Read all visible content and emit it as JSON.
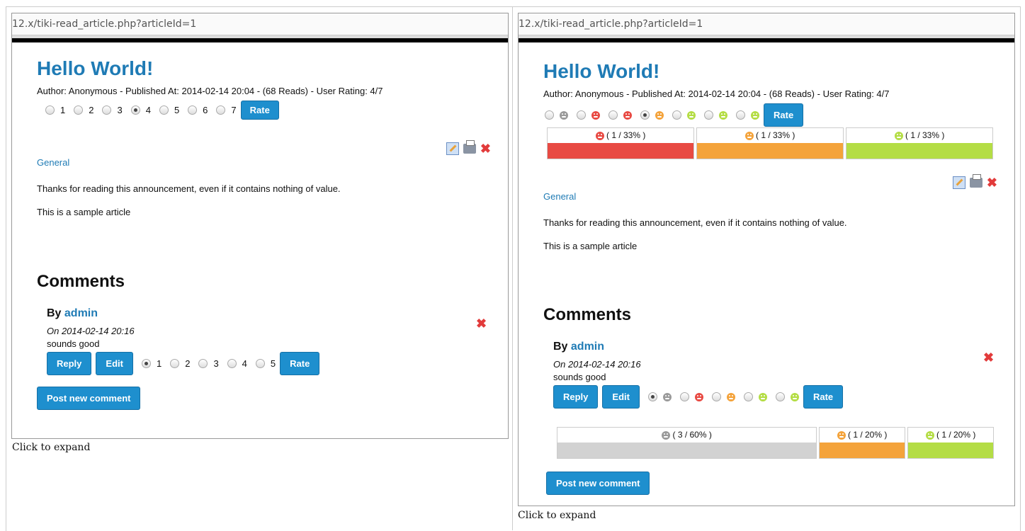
{
  "colors": {
    "link": "#1f7bb5",
    "button": "#1e8fce",
    "bad": "#e84a43",
    "neutral": "#f4a33b",
    "good": "#b4dd45",
    "gray": "#d2d2d2",
    "delete": "#e23b3b"
  },
  "left": {
    "url": "12.x/tiki-read_article.php?articleId=1",
    "title": "Hello World!",
    "meta": "Author: Anonymous - Published At: 2014-02-14 20:04 - (68 Reads) - User Rating: 4/7",
    "rating_options": [
      "1",
      "2",
      "3",
      "4",
      "5",
      "6",
      "7"
    ],
    "rating_selected": "4",
    "rate_label": "Rate",
    "category": "General",
    "para1": "Thanks for reading this announcement, even if it contains nothing of value.",
    "para2": "This is a sample article",
    "comments_heading": "Comments",
    "comment": {
      "by": "By",
      "author": "admin",
      "date": "On 2014-02-14 20:16",
      "text": "sounds good",
      "reply": "Reply",
      "edit": "Edit",
      "rating_options": [
        "1",
        "2",
        "3",
        "4",
        "5"
      ],
      "rating_selected": "1",
      "rate": "Rate"
    },
    "post_new": "Post new comment",
    "caption": "Click to expand"
  },
  "right": {
    "url": "12.x/tiki-read_article.php?articleId=1",
    "title": "Hello World!",
    "meta": "Author: Anonymous - Published At: 2014-02-14 20:04 - (68 Reads) - User Rating: 4/7",
    "rating_icons": [
      "face-gray-icon",
      "face-sad-icon",
      "face-sad-icon",
      "face-neutral-icon",
      "face-happy-icon",
      "face-happy-icon",
      "face-happy-icon"
    ],
    "rating_selected_index": 3,
    "rate_label": "Rate",
    "distribution": [
      {
        "label": "( 1 / 33% )",
        "icon": "face-sad-icon",
        "share": 0.33
      },
      {
        "label": "( 1 / 33% )",
        "icon": "face-neutral-icon",
        "share": 0.33
      },
      {
        "label": "( 1 / 33% )",
        "icon": "face-happy-icon",
        "share": 0.33
      }
    ],
    "category": "General",
    "para1": "Thanks for reading this announcement, even if it contains nothing of value.",
    "para2": "This is a sample article",
    "comments_heading": "Comments",
    "comment": {
      "by": "By",
      "author": "admin",
      "date": "On 2014-02-14 20:16",
      "text": "sounds good",
      "reply": "Reply",
      "edit": "Edit",
      "rating_icons": [
        "face-gray-icon",
        "face-sad-icon",
        "face-neutral-icon",
        "face-happy-icon",
        "face-happy-icon"
      ],
      "rating_selected_index": 0,
      "rate": "Rate",
      "distribution": [
        {
          "label": "( 3 / 60% )",
          "icon": "face-gray-icon",
          "share": 0.6
        },
        {
          "label": "( 1 / 20% )",
          "icon": "face-neutral-icon",
          "share": 0.2
        },
        {
          "label": "( 1 / 20% )",
          "icon": "face-happy-icon",
          "share": 0.2
        }
      ]
    },
    "post_new": "Post new comment",
    "caption": "Click to expand"
  }
}
